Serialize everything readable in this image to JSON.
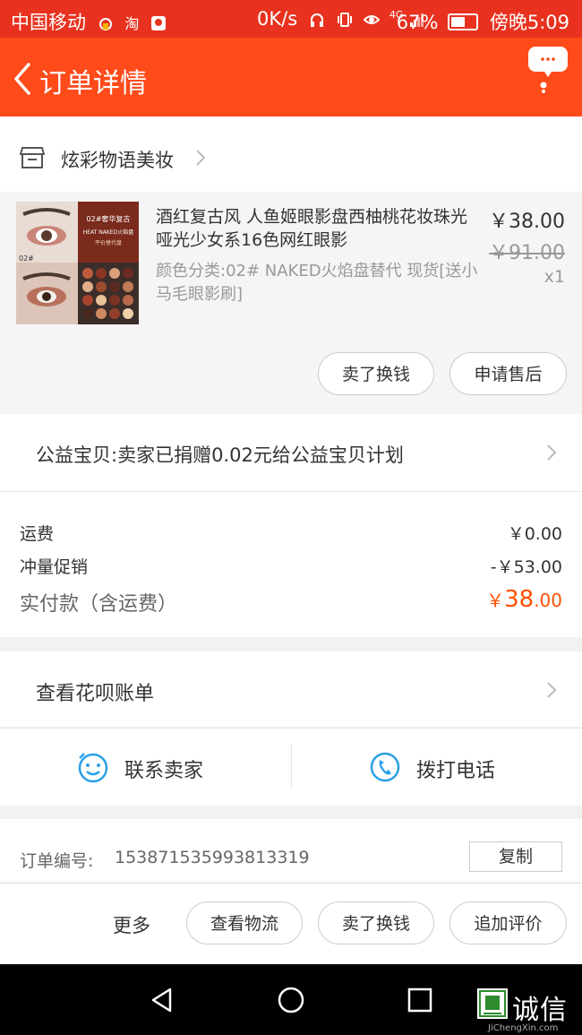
{
  "status_bar": {
    "carrier": "中国移动",
    "app_text": "淘",
    "speed": "0K/s",
    "network": "4G",
    "battery": "67%",
    "battery_level": 0.67,
    "time": "傍晚5:09"
  },
  "header": {
    "title": "订单详情",
    "bubble": "···"
  },
  "shop": {
    "name": "炫彩物语美妆"
  },
  "item": {
    "thumb_caption_1": "02#奢华复古",
    "thumb_caption_2": "HEAT NAKED火焰盘",
    "thumb_caption_3": "平价替代盘",
    "thumb_tag": "02#",
    "title": "酒红复古风 人鱼姬眼影盘西柚桃花妆珠光哑光少女系16色网红眼影",
    "sku": "颜色分类:02# NAKED火焰盘替代 现货[送小马毛眼影刷]",
    "price": "￥38.00",
    "original_price": "￥91.00",
    "quantity": "x1",
    "actions": [
      "卖了换钱",
      "申请售后"
    ]
  },
  "charity": {
    "text": "公益宝贝:卖家已捐赠0.02元给公益宝贝计划"
  },
  "fees": {
    "shipping_label": "运费",
    "shipping_value": "￥0.00",
    "promo_label": "冲量促销",
    "promo_value": "-￥53.00",
    "paid_label": "实付款（含运费）",
    "paid_currency": "￥",
    "paid_int": "38",
    "paid_dec": ".00",
    "accent_color": "#ff5000"
  },
  "huabei": {
    "label": "查看花呗账单"
  },
  "contact": {
    "seller": "联系卖家",
    "call": "拨打电话",
    "icon_color": "#2aa0e6"
  },
  "order": {
    "label": "订单编号:",
    "number": "153871535993813319",
    "copy": "复制"
  },
  "bottom": {
    "more": "更多",
    "buttons": [
      "查看物流",
      "卖了换钱",
      "追加评价"
    ]
  },
  "watermark": {
    "brand": "诚信",
    "site": "JiChengXin.com"
  }
}
